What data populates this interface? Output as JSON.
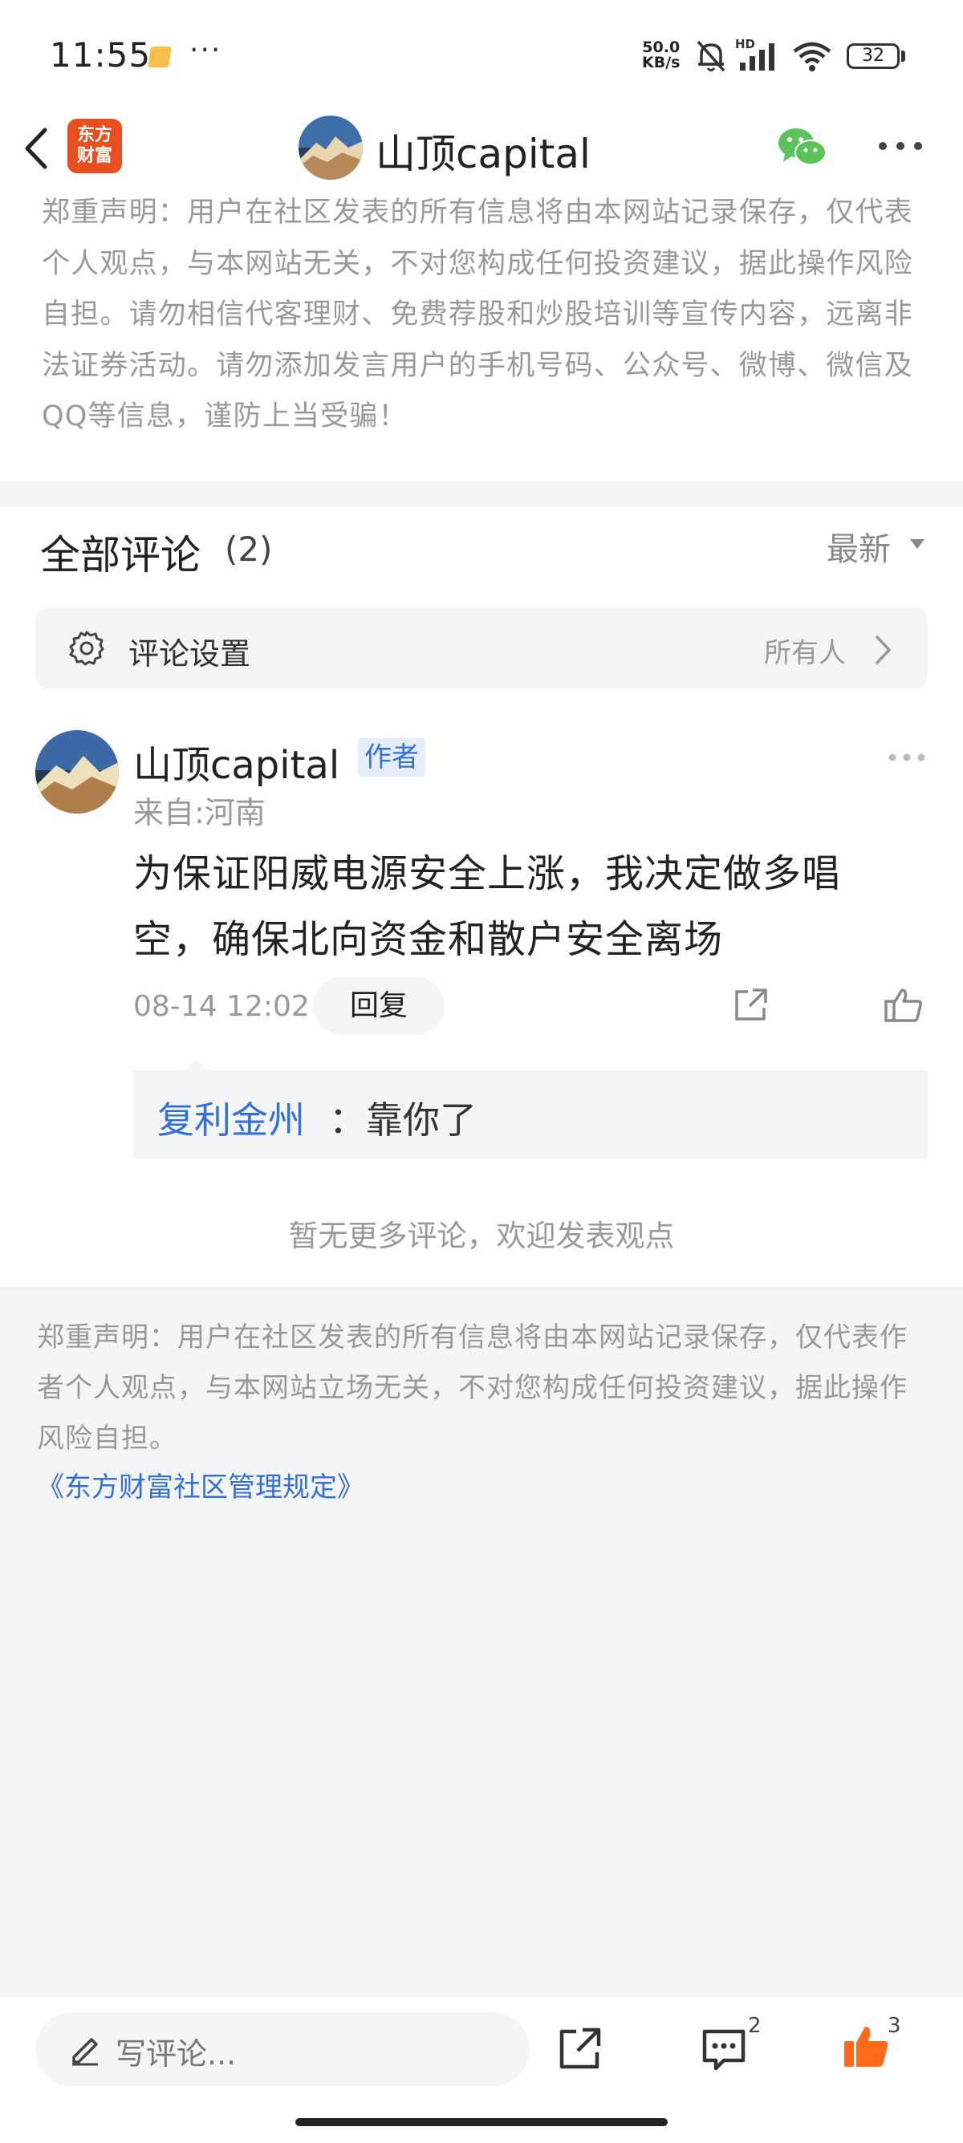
{
  "status_bar": {
    "time": "11:55",
    "net_speed_value": "50.0",
    "net_speed_unit": "KB/s",
    "network_label": "HD",
    "battery": "32",
    "more": "···"
  },
  "header": {
    "app_logo_line1": "东方",
    "app_logo_line2": "财富",
    "title": "山顶capital"
  },
  "disclaimer_top": "郑重声明：用户在社区发表的所有信息将由本网站记录保存，仅代表个人观点，与本网站无关，不对您构成任何投资建议，据此操作风险自担。请勿相信代客理财、免费荐股和炒股培训等宣传内容，远离非法证券活动。请勿添加发言用户的手机号码、公众号、微博、微信及QQ等信息，谨防上当受骗！",
  "comments": {
    "title": "全部评论",
    "count": "(2)",
    "sort_label": "最新",
    "settings_label": "评论设置",
    "settings_value": "所有人",
    "items": [
      {
        "author": "山顶capital",
        "badge": "作者",
        "location": "来自:河南",
        "text": "为保证阳威电源安全上涨，我决定做多唱空，确保北向资金和散户安全离场",
        "time": "08-14 12:02",
        "reply_label": "回复",
        "replies": [
          {
            "name": "复利金州",
            "text": "：靠你了"
          }
        ]
      }
    ],
    "no_more": "暂无更多评论，欢迎发表观点"
  },
  "disclaimer_bottom": "郑重声明：用户在社区发表的所有信息将由本网站记录保存，仅代表作者个人观点，与本网站立场无关，不对您构成任何投资建议，据此操作风险自担。",
  "rules_link": "《东方财富社区管理规定》",
  "bottom_bar": {
    "write_placeholder": "写评论...",
    "comment_count": "2",
    "like_count": "3"
  },
  "colors": {
    "accent_blue": "#3470d6",
    "like_orange": "#ff6a1a",
    "logo_orange": "#e84e1f",
    "wechat_green": "#5cc25a"
  }
}
